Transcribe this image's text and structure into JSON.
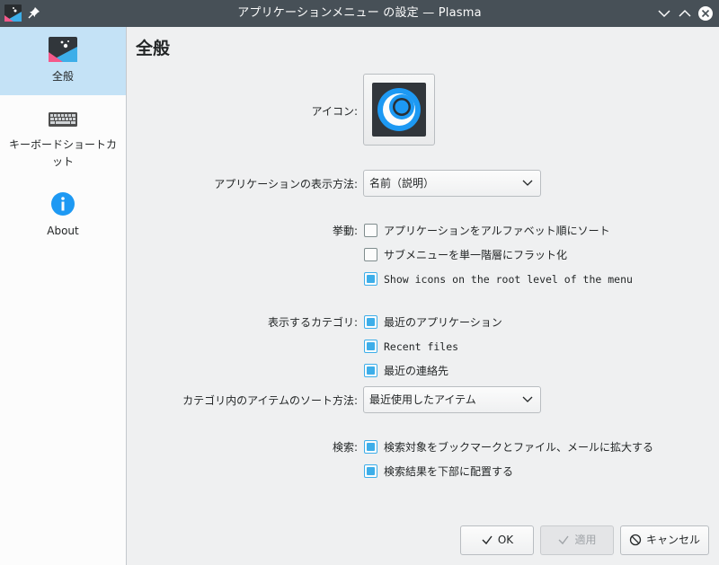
{
  "window": {
    "title": "アプリケーションメニュー の設定 — Plasma"
  },
  "sidebar": {
    "items": [
      {
        "label": "全般",
        "icon": "app-menu-icon",
        "active": true
      },
      {
        "label": "キーボードショートカット",
        "icon": "keyboard-icon",
        "active": false
      },
      {
        "label": "About",
        "icon": "info-icon",
        "active": false
      }
    ]
  },
  "main": {
    "title": "全般",
    "icon_label": "アイコン:",
    "display_label": "アプリケーションの表示方法:",
    "display_value": "名前（説明）",
    "behavior_label": "挙動:",
    "behavior": [
      {
        "label": "アプリケーションをアルファベット順にソート",
        "checked": false
      },
      {
        "label": "サブメニューを単一階層にフラット化",
        "checked": false
      },
      {
        "label": "Show icons on the root level of the menu",
        "checked": true
      }
    ],
    "categories_label": "表示するカテゴリ:",
    "categories": [
      {
        "label": "最近のアプリケーション",
        "checked": true
      },
      {
        "label": "Recent files",
        "checked": true
      },
      {
        "label": "最近の連絡先",
        "checked": true
      }
    ],
    "sort_label": "カテゴリ内のアイテムのソート方法:",
    "sort_value": "最近使用したアイテム",
    "search_label": "検索:",
    "search": [
      {
        "label": "検索対象をブックマークとファイル、メールに拡大する",
        "checked": true
      },
      {
        "label": "検索結果を下部に配置する",
        "checked": true
      }
    ]
  },
  "buttons": {
    "ok": "OK",
    "apply": "適用",
    "cancel": "キャンセル"
  },
  "colors": {
    "titlebar": "#475057",
    "accent": "#3daee9",
    "selection": "#c4e2f6"
  }
}
